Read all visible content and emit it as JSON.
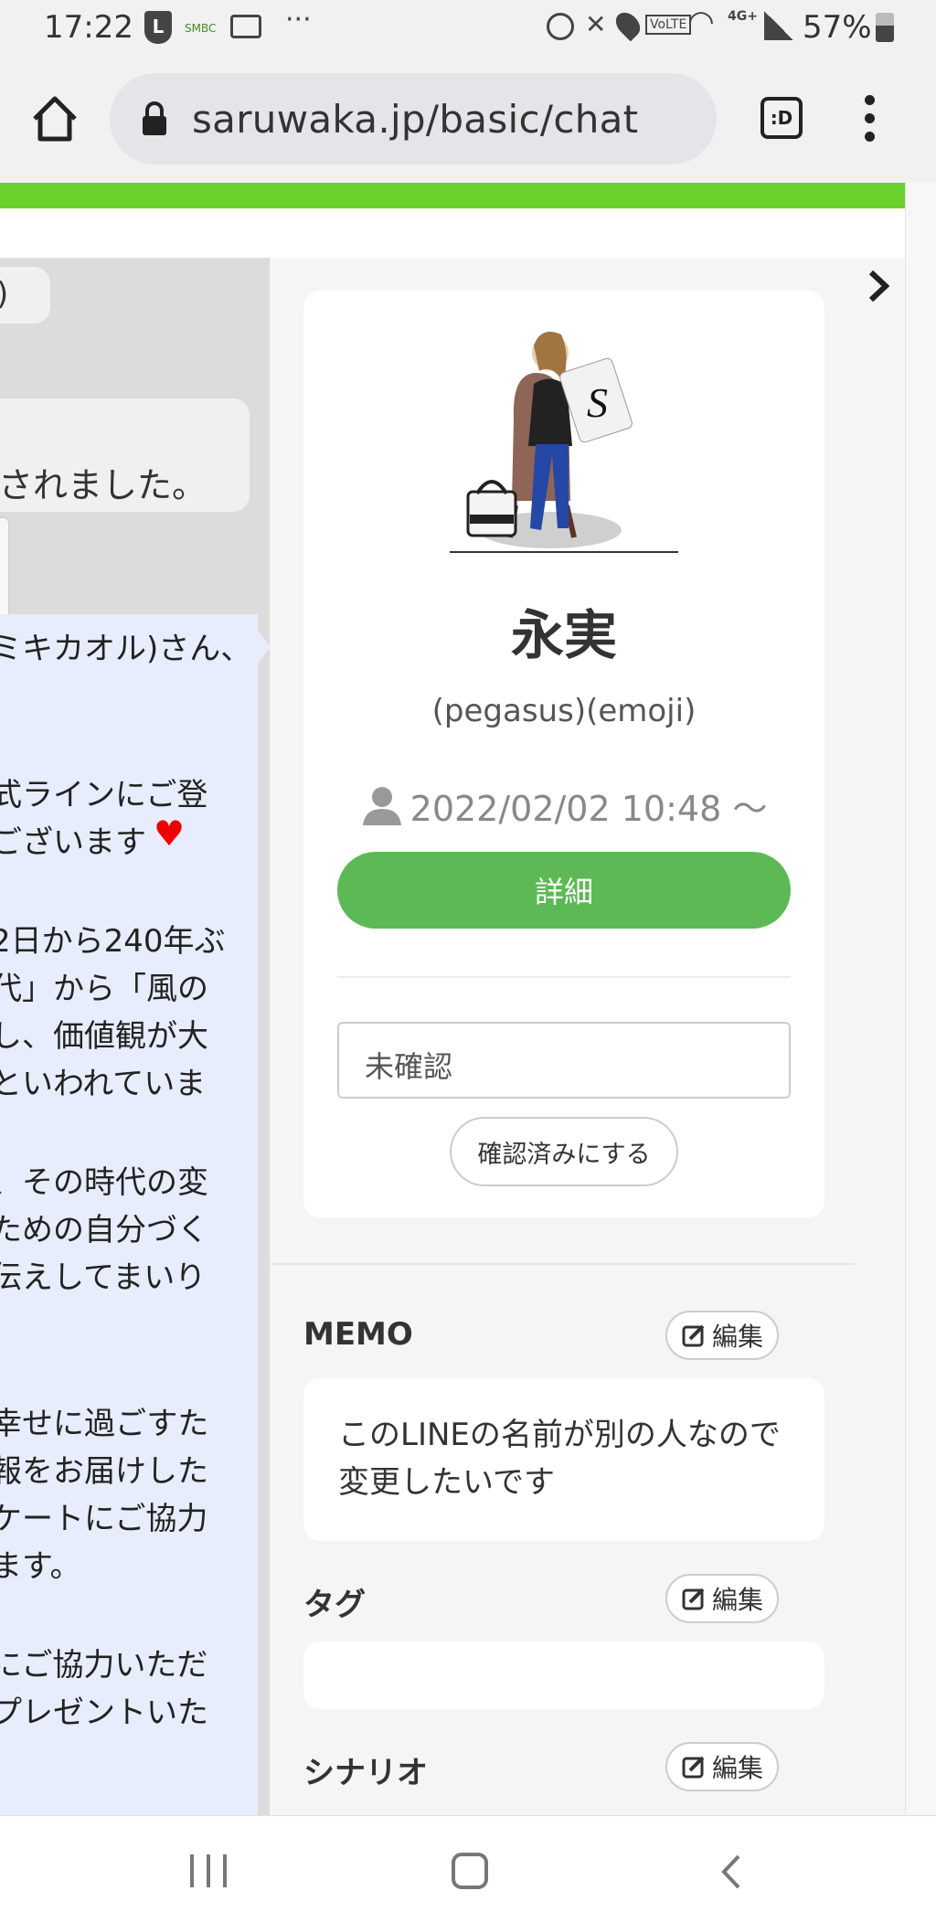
{
  "status_bar": {
    "time": "17:22",
    "battery": "57%",
    "icons": [
      "line-icon",
      "smbc-icon",
      "video-off-icon",
      "more-dots-icon",
      "alarm-icon",
      "mute-icon",
      "location-icon",
      "volte-icon",
      "wifi-icon",
      "4g-icon",
      "signal-icon",
      "battery-icon"
    ],
    "network_label": "4G+",
    "volte_label": "VoLTE"
  },
  "browser": {
    "url": "saruwaka.jp/basic/chat",
    "tab_label": ":D"
  },
  "chat": {
    "top_bubble_text": ")",
    "system_message": "されました。",
    "message_lines": [
      "ミキカオル)さん、",
      "",
      "式ラインにご登",
      "ございます",
      "",
      "2日から240年ぶ",
      "代」から「風の",
      "し、価値観が大",
      "といわれていま",
      "",
      "、その時代の変",
      "ための自分づく",
      "伝えしてまいり",
      "",
      "",
      "幸せに過ごすた",
      "報をお届けした",
      "ケートにご協力",
      "ます。",
      "",
      "にご協力いただ",
      "プレゼントいた"
    ]
  },
  "profile": {
    "name": "永実",
    "subtitle": "(pegasus)(emoji)",
    "since": "2022/02/02 10:48 ～",
    "detail_button": "詳細",
    "status_value": "未確認",
    "confirm_button": "確認済みにする"
  },
  "sections": {
    "memo": {
      "title": "MEMO",
      "edit": "編集",
      "text": "このLINEの名前が別の人なので変更したいです"
    },
    "tags": {
      "title": "タグ",
      "edit": "編集"
    },
    "scenario": {
      "title": "シナリオ",
      "edit": "編集"
    }
  },
  "colors": {
    "accent_green": "#5db955",
    "top_bar_green": "#6ad12c",
    "chat_blue": "#e7edfd"
  }
}
